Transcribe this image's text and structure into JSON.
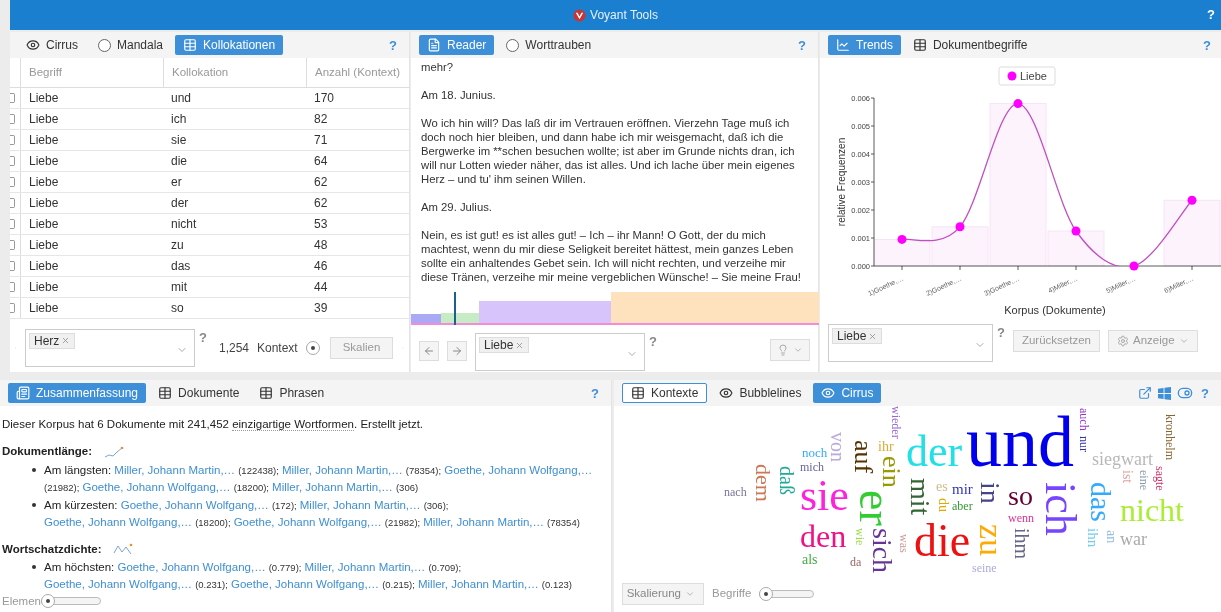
{
  "app": {
    "title": "Voyant Tools",
    "help": "?"
  },
  "collocates_panel": {
    "tabs": [
      {
        "label": "Cirrus",
        "selected": false
      },
      {
        "label": "Mandala",
        "selected": false
      },
      {
        "label": "Kollokationen",
        "selected": true
      }
    ],
    "help": "?",
    "columns": [
      "Begriff",
      "Kollokation",
      "Anzahl (Kontext)"
    ],
    "rows": [
      {
        "term": "Liebe",
        "collocate": "und",
        "count": "170",
        "checked": false
      },
      {
        "term": "Liebe",
        "collocate": "ich",
        "count": "82",
        "checked": false
      },
      {
        "term": "Liebe",
        "collocate": "sie",
        "count": "71",
        "checked": false
      },
      {
        "term": "Liebe",
        "collocate": "die",
        "count": "64",
        "checked": false
      },
      {
        "term": "Liebe",
        "collocate": "er",
        "count": "62",
        "checked": false
      },
      {
        "term": "Liebe",
        "collocate": "der",
        "count": "62",
        "checked": false
      },
      {
        "term": "Liebe",
        "collocate": "nicht",
        "count": "53",
        "checked": false
      },
      {
        "term": "Liebe",
        "collocate": "zu",
        "count": "48",
        "checked": false
      },
      {
        "term": "Liebe",
        "collocate": "das",
        "count": "46",
        "checked": false
      },
      {
        "term": "Liebe",
        "collocate": "mit",
        "count": "44",
        "checked": false
      },
      {
        "term": "Liebe",
        "collocate": "so",
        "count": "39",
        "checked": false
      }
    ],
    "query_tags": [
      "Herz"
    ],
    "field_help": "?",
    "count": "1,254",
    "context_label": "Kontext",
    "scale_button": "Skalien"
  },
  "reader_panel": {
    "tabs": [
      {
        "label": "Reader",
        "selected": true
      },
      {
        "label": "Worttrauben",
        "selected": false
      }
    ],
    "help": "?",
    "paragraphs": [
      "mehr?",
      "Am 18. Junius.",
      "Wo ich hin will? Das laß dir im Vertrauen eröffnen. Vierzehn Tage muß ich doch noch hier bleiben, und dann habe ich mir weisgemacht, daß ich die Bergwerke im **schen besuchen wollte; ist aber im Grunde nichts dran, ich will nur Lotten wieder näher, das ist alles. Und ich lache über mein eigenes Herz – und tu' ihm seinen Willen.",
      "Am 29. Julius.",
      "Nein, es ist gut! es ist alles gut! – Ich – ihr Mann! O Gott, der du mich machtest, wenn du mir diese Seligkeit bereitet hättest, mein ganzes Leben sollte ein anhaltendes Gebet sein. Ich will nicht rechten, und verzeihe mir diese Tränen, verzeihe mir meine vergeblichen Wünsche! – Sie meine Frau!"
    ],
    "query_tags": [
      "Liebe"
    ],
    "field_help": "?"
  },
  "trends_panel": {
    "tabs": [
      {
        "label": "Trends",
        "selected": true
      },
      {
        "label": "Dokumentbegriffe",
        "selected": false
      }
    ],
    "help": "?",
    "chart_data": {
      "type": "line",
      "xlabel": "Korpus (Dokumente)",
      "ylabel": "relative Frequenzen",
      "categories": [
        "1)Goethe,…",
        "2)Goethe,…",
        "3)Goethe,…",
        "4)Miller,…",
        "5)Miller,…",
        "6)Miller,…"
      ],
      "series": [
        {
          "name": "Liebe",
          "color": "#ff00ff",
          "marker": "circle",
          "values": [
            0.00095,
            0.0014,
            0.0058,
            0.00125,
            0.0,
            0.00235
          ]
        },
        {
          "type": "bar",
          "color": "#fdf3fd",
          "values": [
            0.00095,
            0.0014,
            0.0058,
            0.00125,
            0.0,
            0.00235
          ]
        }
      ],
      "ylim": [
        0,
        0.006
      ],
      "yticks": [
        {
          "value": 0,
          "label": "0.000"
        },
        {
          "value": 0.001,
          "label": "0.001"
        },
        {
          "value": 0.002,
          "label": "0.002"
        },
        {
          "value": 0.003,
          "label": "0.003"
        },
        {
          "value": 0.004,
          "label": "0.004"
        },
        {
          "value": 0.005,
          "label": "0.005"
        },
        {
          "value": 0.006,
          "label": "0.006"
        }
      ]
    },
    "query_tags": [
      "Liebe"
    ],
    "field_help": "?",
    "reset_button": "Zurücksetzen",
    "display_button": "Anzeige"
  },
  "summary_panel": {
    "tabs": [
      {
        "label": "Zusammenfassung",
        "selected": true
      },
      {
        "label": "Dokumente",
        "selected": false
      },
      {
        "label": "Phrasen",
        "selected": false
      }
    ],
    "help": "?",
    "intro": {
      "before": "Dieser Korpus hat 6 Dokumente mit 241,452 ",
      "term": "einzigartige Wortformen",
      "after": ". Erstellt jetzt."
    },
    "sections": [
      {
        "title": "Dokumentlänge:",
        "items": [
          {
            "label": "Am längsten:",
            "entries": [
              {
                "name": "Miller, Johann Martin,…",
                "value": "(122438);"
              },
              {
                "name": "Miller, Johann Martin,…",
                "value": "(78354);"
              },
              {
                "name": "Goethe, Johann Wolfgang,…",
                "value": "(21982);"
              },
              {
                "name": "Goethe, Johann Wolfgang,…",
                "value": "(18200);"
              },
              {
                "name": "Miller, Johann Martin,…",
                "value": "(306)"
              }
            ]
          },
          {
            "label": "Am kürzesten:",
            "entries": [
              {
                "name": "Goethe, Johann Wolfgang,…",
                "value": "(172);"
              },
              {
                "name": "Miller, Johann Martin,…",
                "value": "(306);"
              },
              {
                "name": "Goethe, Johann Wolfgang,…",
                "value": "(18200);"
              },
              {
                "name": "Goethe, Johann Wolfgang,…",
                "value": "(21982);"
              },
              {
                "name": "Miller, Johann Martin,…",
                "value": "(78354)"
              }
            ]
          }
        ]
      },
      {
        "title": "Wortschatzdichte:",
        "items": [
          {
            "label": "Am höchsten:",
            "entries": [
              {
                "name": "Goethe, Johann Wolfgang,…",
                "value": "(0.779);"
              },
              {
                "name": "Miller, Johann Martin,…",
                "value": "(0.709);"
              },
              {
                "name": "Goethe, Johann Wolfgang,…",
                "value": "(0.231);"
              },
              {
                "name": "Goethe, Johann Wolfgang,…",
                "value": "(0.215);"
              },
              {
                "name": "Miller, Johann Martin,…",
                "value": "(0.123)"
              }
            ]
          }
        ]
      }
    ],
    "elements_label": "Elemen"
  },
  "cirrus_panel": {
    "tabs": [
      {
        "label": "Kontexte",
        "selected": false,
        "focused": true
      },
      {
        "label": "Bubblelines",
        "selected": false,
        "focused": false
      },
      {
        "label": "Cirrus",
        "selected": true,
        "focused": false
      }
    ],
    "help": "?",
    "words": [
      {
        "text": "nach",
        "color": "#777799"
      },
      {
        "text": "dem",
        "color": "#cc7755"
      },
      {
        "text": "daß",
        "color": "#22aa99"
      },
      {
        "text": "noch",
        "color": "#33aaff"
      },
      {
        "text": "mich",
        "color": "#666699"
      },
      {
        "text": "sie",
        "color": "#ff22dd"
      },
      {
        "text": "den",
        "color": "#ee1188"
      },
      {
        "text": "als",
        "color": "#44aa44"
      },
      {
        "text": "von",
        "color": "#bbaadd"
      },
      {
        "text": "da",
        "color": "#996666"
      },
      {
        "text": "auf",
        "color": "#553300"
      },
      {
        "text": "er",
        "color": "#33cc33"
      },
      {
        "text": "wie",
        "color": "#99dd44"
      },
      {
        "text": "sich",
        "color": "#663399"
      },
      {
        "text": "ihr",
        "color": "#ddaa33"
      },
      {
        "text": "ein",
        "color": "#999900"
      },
      {
        "text": "wieder",
        "color": "#9966cc"
      },
      {
        "text": "was",
        "color": "#cc9999"
      },
      {
        "text": "mit",
        "color": "#336633"
      },
      {
        "text": "der",
        "color": "#22e0e8"
      },
      {
        "text": "es",
        "color": "#ccbb88"
      },
      {
        "text": "du",
        "color": "#ddaa00"
      },
      {
        "text": "mir",
        "color": "#3333bb"
      },
      {
        "text": "aber",
        "color": "#339933"
      },
      {
        "text": "die",
        "color": "#ee1111"
      },
      {
        "text": "und",
        "color": "#0000ee"
      },
      {
        "text": "seine",
        "color": "#aaaadd"
      },
      {
        "text": "in",
        "color": "#444488"
      },
      {
        "text": "zu",
        "color": "#ffaa00"
      },
      {
        "text": "so",
        "color": "#660033"
      },
      {
        "text": "wenn",
        "color": "#dd3399"
      },
      {
        "text": "ihm",
        "color": "#666688"
      },
      {
        "text": "ich",
        "color": "#7744ff"
      },
      {
        "text": "auch",
        "color": "#9933cc"
      },
      {
        "text": "nur",
        "color": "#3333aa"
      },
      {
        "text": "das",
        "color": "#33aaff"
      },
      {
        "text": "ihn",
        "color": "#77ccee"
      },
      {
        "text": "siegwart",
        "color": "#b8b8b8"
      },
      {
        "text": "an",
        "color": "#99bbdd"
      },
      {
        "text": "ist",
        "color": "#e0a0a0"
      },
      {
        "text": "nicht",
        "color": "#aaee33"
      },
      {
        "text": "war",
        "color": "#aaaaaa"
      },
      {
        "text": "eine",
        "color": "#8899aa"
      },
      {
        "text": "sagte",
        "color": "#cc3366"
      },
      {
        "text": "kronhelm",
        "color": "#886633"
      }
    ],
    "scale_dropdown": "Skalierung",
    "terms_label": "Begriffe"
  }
}
